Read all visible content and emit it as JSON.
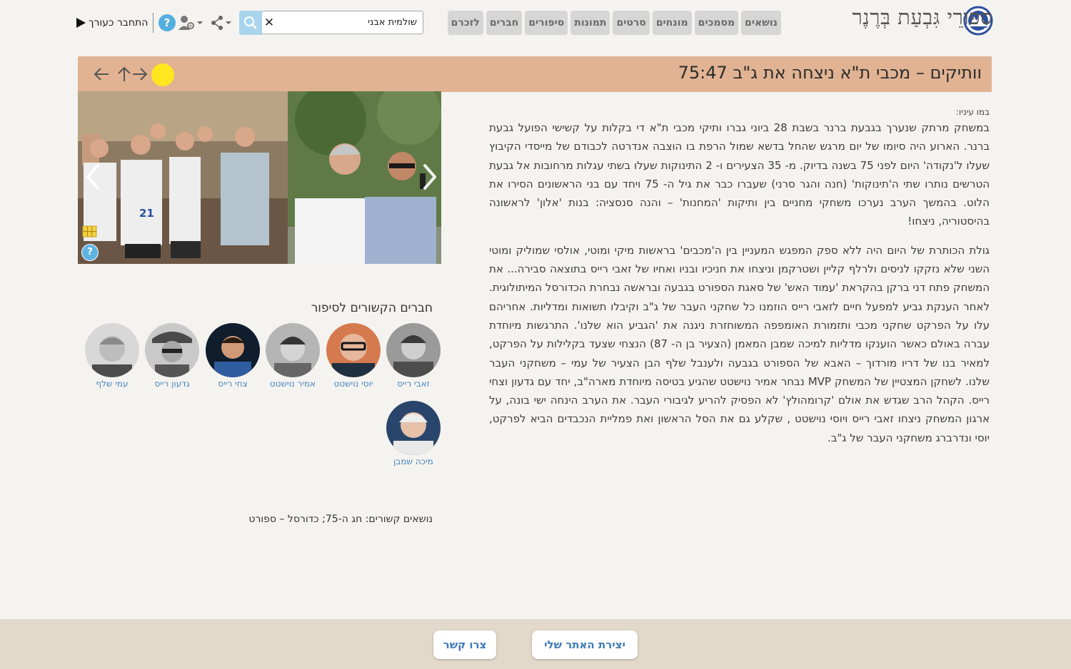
{
  "header": {
    "site_title": "סִפּוּרֵי גִּבְעַת בְּרֶנֶר",
    "nav_tabs": [
      "לזכרם",
      "חברים",
      "סיפורים",
      "תמונות",
      "סרטים",
      "מונחים",
      "מסמכים",
      "נושאים"
    ],
    "search_value": "שולמית אבני",
    "search_clear": "✕",
    "help_label": "?",
    "login_label": "התחבר כעורך",
    "icons": [
      "logo-icon",
      "search-icon",
      "share-icon",
      "user-settings-icon",
      "help-icon",
      "play-icon"
    ]
  },
  "story": {
    "title": "וותיקים – מכבי ת\"א ניצחה את ג\"ב 75:47",
    "byline": "במו עיניו:",
    "paragraphs": [
      "במשחק מרתק שנערך בגבעת ברנר בשבת 28 ביוני גברו ותיקי מכבי ת\"א די בקלות על קשישי הפועל גבעת ברנר. הארוע היה סיומו של יום מרגש שהחל בדשא שמול הרפת בו הוצבה אנדרטה לכבודם של מייסדי הקיבוץ שעלו ל'נקודה' היום לפני 75 בשנה בדיוק. מ- 35 הצעירים ו- 2 התינוקות שעלו בשתי עגלות מרחובות אל גבעת הטרשים נותרו שתי ה'תינוקות' (חנה והגר סרני) שעברו כבר את גיל ה- 75 ויחד עם בני הראשונים הסירו את הלוט. בהמשך הערב נערכו משחקי מחניים בין ותיקות 'המחנות' – והנה סנסציה: בנות 'אלון' לראשונה בהיסטוריה, ניצחו!",
      "גולת הכותרת של היום היה ללא ספק המפגש המעניין בין ה'מכבים' בראשות מיקי ומוטי, אולסי שמוליק ומוטי השני שלא נזקקו לניסים ולרלף קליין ושטרקמן וניצחו את חניכיו ובניו ואחיו של זאבי רייס בתוצאה סבירה... את המשחק פתח דני ברקן בהקראת 'עמוד האש' של סאגת הספורט בגבעה ובראשה נבחרת הכדורסל המיתולוגית. לאחר הענקת גביע למפעל חיים לזאבי רייס הוזמנו כל שחקני העבר של ג\"ב וקיבלו תשואות ומדליות. אחריהם עלו על הפרקט שחקני מכבי ותזמורת האומפפה המשוחזרת ניגנה את 'הגביע הוא שלנו'. התרגשות מיוחדת עברה באולם כאשר הוענקו מדליות למיכה שמבן המאמן (הצעיר בן ה- 87) הנצחי שצעד בקלילות על הפרקט, למאיר בנו של דריו מורדוך – האבא של הספורט בגבעה ולענבל שלף הבן הצעיר של עמי – משחקני העבר שלנו. לשחקן המצטיין של המשחק MVP נבחר אמיר נוישטט שהגיע בטיסה מיוחדת מארה\"ב, יחד עם גדעון וצחי רייס. הקהל הרב שגדש את אולם 'קרומהולץ' לא הפסיק להריע לגיבורי העבר. את הערב הינחה ישי בונה, על ארגון המשחק ניצחו זאבי רייס ויוסי נוישטט , שקלע גם את הסל הראשון ואת פמליית הנכבדים הביא לפרקט, יוסי ונדרברג משחקני העבר של ג\"ב."
    ]
  },
  "gallery": {
    "help_label": "?",
    "icons": [
      "chevron-left-icon",
      "chevron-right-icon",
      "grid-icon",
      "help-icon"
    ]
  },
  "members": {
    "heading": "חברים הקשורים לסיפור",
    "people": [
      "זאבי רייס",
      "יוסי נוישטט",
      "אמיר נוישטט",
      "צחי רייס",
      "גדעון רייס",
      "עמי שלף",
      "מיכה שמבן"
    ]
  },
  "related_topics": "נושאים קשורים: חג ה-75; כדורסל – ספורט",
  "footer": {
    "create_site": "יצירת האתר שלי",
    "contact": "צרו קשר"
  },
  "colors": {
    "story_bar": "#e1b393",
    "nav_tab": "#d6d6d6",
    "link": "#4a86c0",
    "footer": "#e3d9cb",
    "search_button": "#a9d5ec",
    "cursor_highlight": "#ffe61f"
  }
}
